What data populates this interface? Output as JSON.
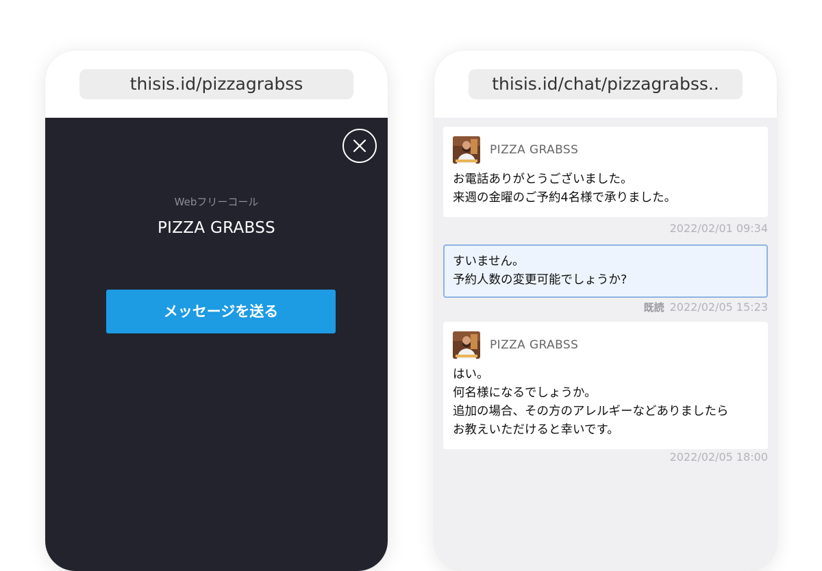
{
  "left_phone": {
    "url": "thisis.id/pizzagrabss",
    "call_label": "Webフリーコール",
    "business_name": "PIZZA GRABSS",
    "send_button_label": "メッセージを送る",
    "close_icon": "close-icon"
  },
  "right_phone": {
    "url": "thisis.id/chat/pizzagrabss..",
    "messages": [
      {
        "sender": "PIZZA GRABSS",
        "lines": [
          "お電話ありがとうございました。",
          "来週の金曜のご予約4名様で承りました。"
        ],
        "timestamp": "2022/02/01 09:34"
      },
      {
        "sender": "",
        "lines": [
          "すいません。",
          "予約人数の変更可能でしょうか?"
        ],
        "read_label": "既読",
        "timestamp": "2022/02/05 15:23"
      },
      {
        "sender": "PIZZA GRABSS",
        "lines": [
          "はい。",
          "何名様になるでしょうか。",
          "追加の場合、その方のアレルギーなどありましたら",
          "お教えいただけると幸いです。"
        ],
        "timestamp": "2022/02/05 18:00"
      }
    ]
  },
  "colors": {
    "dark_screen": "#23232d",
    "send_button": "#1d9be3",
    "chat_background": "#f0f0f3",
    "own_bubble": "#edf4fd",
    "own_bubble_border": "#90b3e0"
  }
}
